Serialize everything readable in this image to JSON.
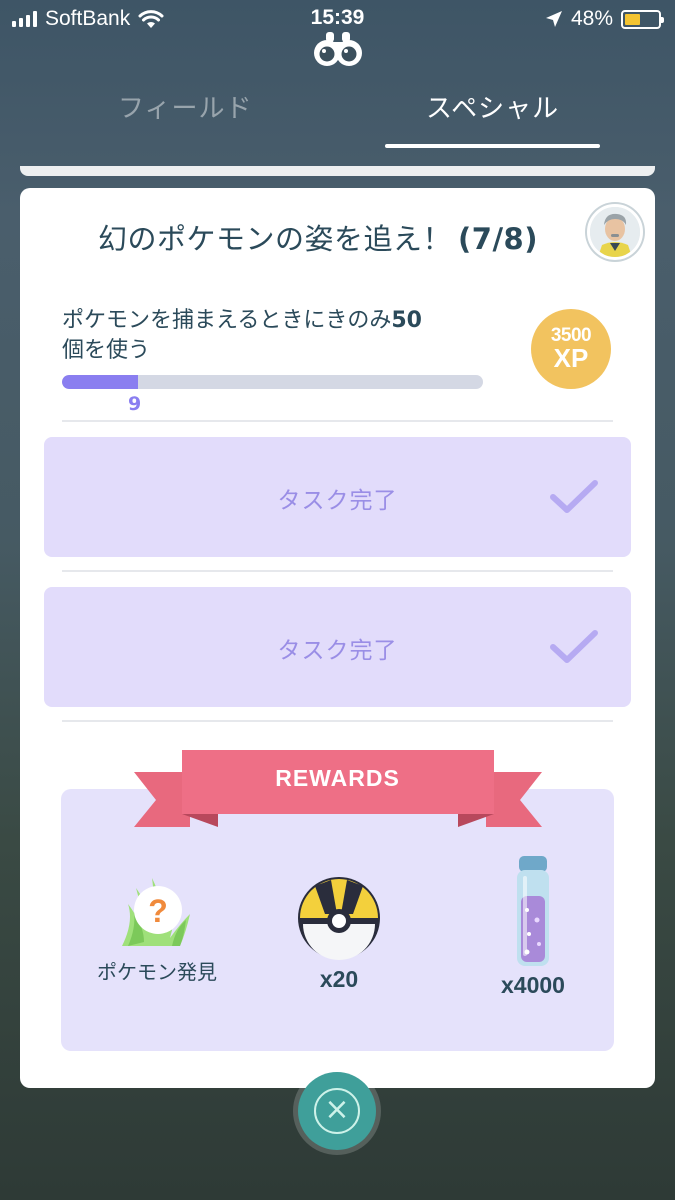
{
  "status_bar": {
    "carrier": "SoftBank",
    "time": "15:39",
    "battery_percent": "48%",
    "battery_level": 0.48
  },
  "tabs": [
    {
      "label": "フィールド",
      "active": false
    },
    {
      "label": "スペシャル",
      "active": true
    }
  ],
  "quest": {
    "title": "幻のポケモンの姿を追え！",
    "count": "(7/8)",
    "task": {
      "text_part1": "ポケモンを捕まえるときにきのみ",
      "text_count": "50",
      "text_part2": "個を使う",
      "progress_value": 9,
      "progress_max": 50,
      "reward_xp": "3500",
      "reward_xp_label": "XP"
    },
    "completed_tasks": [
      {
        "label": "タスク完了"
      },
      {
        "label": "タスク完了"
      }
    ]
  },
  "rewards": {
    "header": "REWARDS",
    "items": [
      {
        "icon": "encounter-grass-icon",
        "label": "ポケモン発見"
      },
      {
        "icon": "ultra-ball-icon",
        "quantity": "x20"
      },
      {
        "icon": "stardust-icon",
        "quantity": "x4000"
      }
    ]
  },
  "colors": {
    "accent_purple": "#8a7ef0",
    "completed_bg": "#e2dcfb",
    "ribbon": "#e8697e",
    "xp_gold": "#f2c35f",
    "close_button": "#3f9f9a"
  }
}
